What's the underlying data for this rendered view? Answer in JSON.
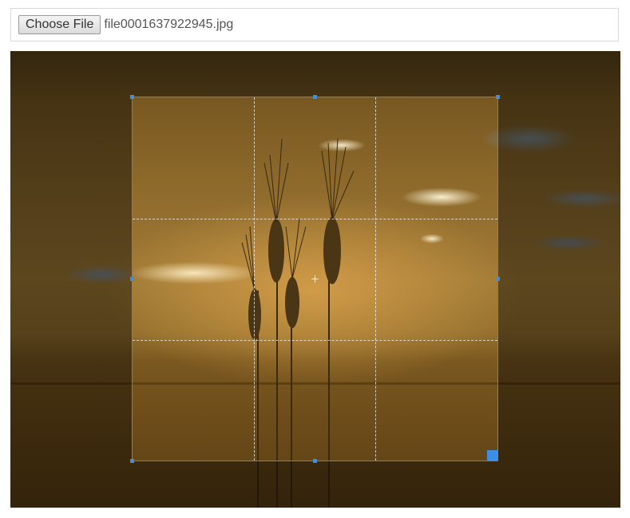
{
  "file_input": {
    "button_label": "Choose File",
    "file_name": "file0001637922945.jpg"
  },
  "image": {
    "description_icon": "wheat-field-sunset-image"
  },
  "cropper": {
    "accent_color": "#3b8fe6"
  }
}
